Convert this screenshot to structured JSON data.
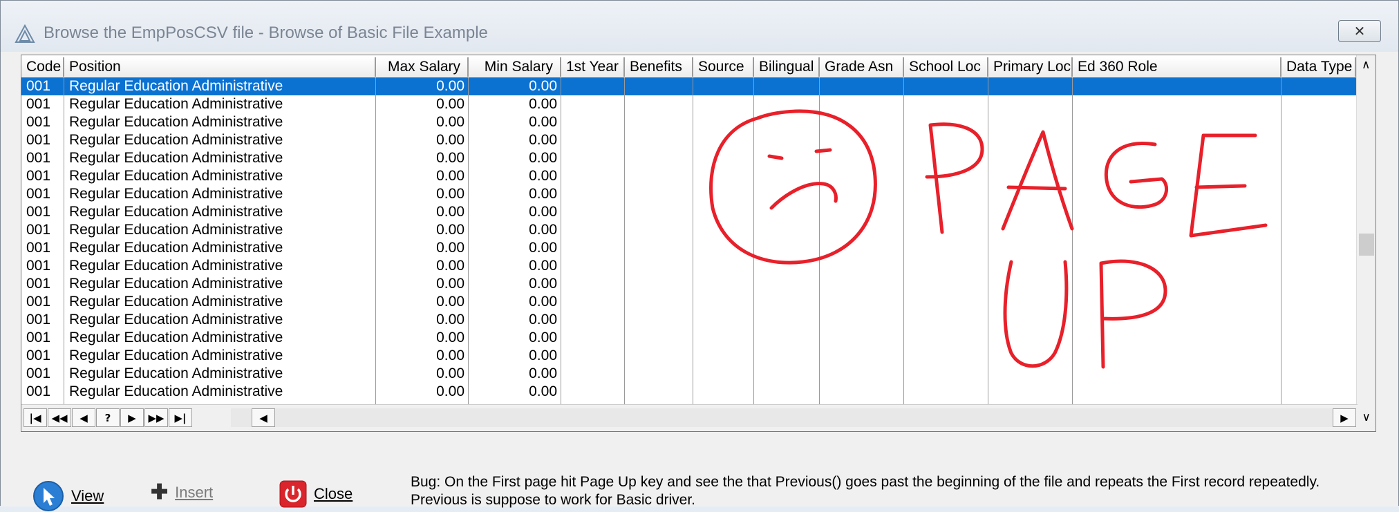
{
  "window": {
    "title": "Browse the EmpPosCSV file - Browse of Basic File Example",
    "close_glyph": "✕"
  },
  "grid": {
    "columns": [
      {
        "label": "Code"
      },
      {
        "label": "Position"
      },
      {
        "label": "Max Salary"
      },
      {
        "label": "Min Salary"
      },
      {
        "label": "1st Year"
      },
      {
        "label": "Benefits"
      },
      {
        "label": "Source"
      },
      {
        "label": "Bilingual"
      },
      {
        "label": "Grade Asn"
      },
      {
        "label": "School Loc"
      },
      {
        "label": "Primary Loc"
      },
      {
        "label": "Ed 360 Role"
      },
      {
        "label": "Data Type"
      }
    ],
    "rows": [
      {
        "code": "001",
        "position": "Regular Education Administrative",
        "max_salary": "0.00",
        "min_salary": "0.00"
      },
      {
        "code": "001",
        "position": "Regular Education Administrative",
        "max_salary": "0.00",
        "min_salary": "0.00"
      },
      {
        "code": "001",
        "position": "Regular Education Administrative",
        "max_salary": "0.00",
        "min_salary": "0.00"
      },
      {
        "code": "001",
        "position": "Regular Education Administrative",
        "max_salary": "0.00",
        "min_salary": "0.00"
      },
      {
        "code": "001",
        "position": "Regular Education Administrative",
        "max_salary": "0.00",
        "min_salary": "0.00"
      },
      {
        "code": "001",
        "position": "Regular Education Administrative",
        "max_salary": "0.00",
        "min_salary": "0.00"
      },
      {
        "code": "001",
        "position": "Regular Education Administrative",
        "max_salary": "0.00",
        "min_salary": "0.00"
      },
      {
        "code": "001",
        "position": "Regular Education Administrative",
        "max_salary": "0.00",
        "min_salary": "0.00"
      },
      {
        "code": "001",
        "position": "Regular Education Administrative",
        "max_salary": "0.00",
        "min_salary": "0.00"
      },
      {
        "code": "001",
        "position": "Regular Education Administrative",
        "max_salary": "0.00",
        "min_salary": "0.00"
      },
      {
        "code": "001",
        "position": "Regular Education Administrative",
        "max_salary": "0.00",
        "min_salary": "0.00"
      },
      {
        "code": "001",
        "position": "Regular Education Administrative",
        "max_salary": "0.00",
        "min_salary": "0.00"
      },
      {
        "code": "001",
        "position": "Regular Education Administrative",
        "max_salary": "0.00",
        "min_salary": "0.00"
      },
      {
        "code": "001",
        "position": "Regular Education Administrative",
        "max_salary": "0.00",
        "min_salary": "0.00"
      },
      {
        "code": "001",
        "position": "Regular Education Administrative",
        "max_salary": "0.00",
        "min_salary": "0.00"
      },
      {
        "code": "001",
        "position": "Regular Education Administrative",
        "max_salary": "0.00",
        "min_salary": "0.00"
      },
      {
        "code": "001",
        "position": "Regular Education Administrative",
        "max_salary": "0.00",
        "min_salary": "0.00"
      },
      {
        "code": "001",
        "position": "Regular Education Administrative",
        "max_salary": "0.00",
        "min_salary": "0.00"
      }
    ],
    "selected_row": 0,
    "navigator": {
      "first": "|◀",
      "prev_page": "◀◀",
      "prev": "◀",
      "query": "?",
      "next": "▶",
      "next_page": "▶▶",
      "last": "▶|",
      "scroll_left": "◀",
      "scroll_right": "▶",
      "scroll_up": "∧",
      "scroll_down": "∨"
    }
  },
  "actions": {
    "view": "View",
    "insert": "Insert",
    "close": "Close"
  },
  "bug_note": "Bug: On the First page hit Page Up key and see the that Previous() goes past the beginning of the file and repeats the First record repeatedly. Previous is suppose to work for Basic driver.",
  "annotation": {
    "line1": "PAGE",
    "line2": "UP",
    "color": "#e8202a"
  },
  "colors": {
    "selection": "#0b72d2",
    "close_icon": "#d9252b",
    "view_icon": "#2a7fd4"
  }
}
